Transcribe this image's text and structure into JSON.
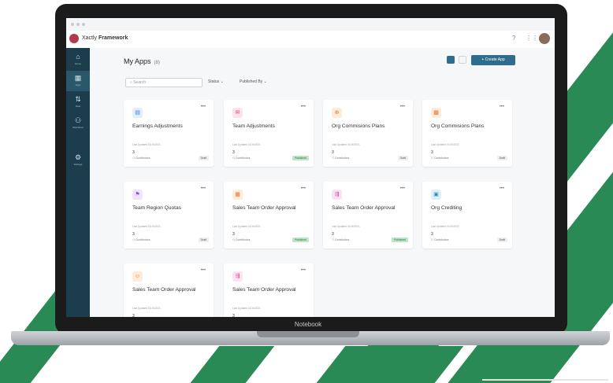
{
  "brand": {
    "name_light": "Xactly ",
    "name_bold": "Framework"
  },
  "sidebar": {
    "items": [
      {
        "icon": "⌂",
        "label": "Home"
      },
      {
        "icon": "▦",
        "label": "Apps"
      },
      {
        "icon": "⇅",
        "label": "Data"
      },
      {
        "icon": "⚇",
        "label": "Workflows"
      },
      {
        "icon": "⚙",
        "label": "Settings"
      }
    ]
  },
  "page": {
    "title": "My Apps",
    "count": "(8)"
  },
  "toolbar": {
    "create_label": "+ Create App",
    "search_placeholder": "Search",
    "filter_status": "Status ⌄",
    "filter_published": "Published By ⌄"
  },
  "cards": [
    {
      "title": "Earnings Adjustments",
      "icon": "▤",
      "color": "#3a7bd5",
      "bg": "#e3eefc",
      "updated": "Last Updated 01/16/2021",
      "count": "3",
      "contributors": "Contributors",
      "status": "Draft"
    },
    {
      "title": "Team Adjustments",
      "icon": "✉",
      "color": "#d63b6e",
      "bg": "#fbe3ec",
      "updated": "Last Updated 01/16/2021",
      "count": "3",
      "contributors": "Contributors",
      "status": "Published"
    },
    {
      "title": "Org Commisions Plans",
      "icon": "⊕",
      "color": "#e07a2e",
      "bg": "#fdebdc",
      "updated": "Last Updated 01/16/2021",
      "count": "3",
      "contributors": "Contributors",
      "status": "Draft"
    },
    {
      "title": "Org Commisions Plans",
      "icon": "▩",
      "color": "#e07a2e",
      "bg": "#fdebdc",
      "updated": "Last Updated 01/16/2021",
      "count": "3",
      "contributors": "Contributors",
      "status": "Draft"
    },
    {
      "title": "Team Region Quotas",
      "icon": "⚑",
      "color": "#8a4fcf",
      "bg": "#efe5fb",
      "updated": "Last Updated 01/16/2021",
      "count": "3",
      "contributors": "Contributors",
      "status": "Draft"
    },
    {
      "title": "Sales Team Order Approval",
      "icon": "▦",
      "color": "#e07a2e",
      "bg": "#fdebdc",
      "updated": "Last Updated 01/16/2021",
      "count": "3",
      "contributors": "Contributors",
      "status": "Published"
    },
    {
      "title": "Sales Team Order Approval",
      "icon": "⇶",
      "color": "#d63b9a",
      "bg": "#fbe3f2",
      "updated": "Last Updated 01/16/2021",
      "count": "3",
      "contributors": "Contributors",
      "status": "Published"
    },
    {
      "title": "Org Crediting",
      "icon": "▣",
      "color": "#2d8fb0",
      "bg": "#dff1f7",
      "updated": "Last Updated 01/16/2021",
      "count": "3",
      "contributors": "Contributors",
      "status": "Draft"
    },
    {
      "title": "Sales Team Order Approval",
      "icon": "☺",
      "color": "#e07a2e",
      "bg": "#fdebdc",
      "updated": "Last Updated 01/16/2021",
      "count": "3",
      "contributors": "",
      "status": ""
    },
    {
      "title": "Sales Team Order Approval",
      "icon": "⇶",
      "color": "#d63b9a",
      "bg": "#fbe3f2",
      "updated": "Last Updated 01/16/2021",
      "count": "3",
      "contributors": "",
      "status": ""
    }
  ],
  "laptop": {
    "label": "Notebook"
  },
  "colors": {
    "accent": "#2d6e8e",
    "sidebar": "#1c3d4c",
    "stripe": "#2a8a55"
  }
}
